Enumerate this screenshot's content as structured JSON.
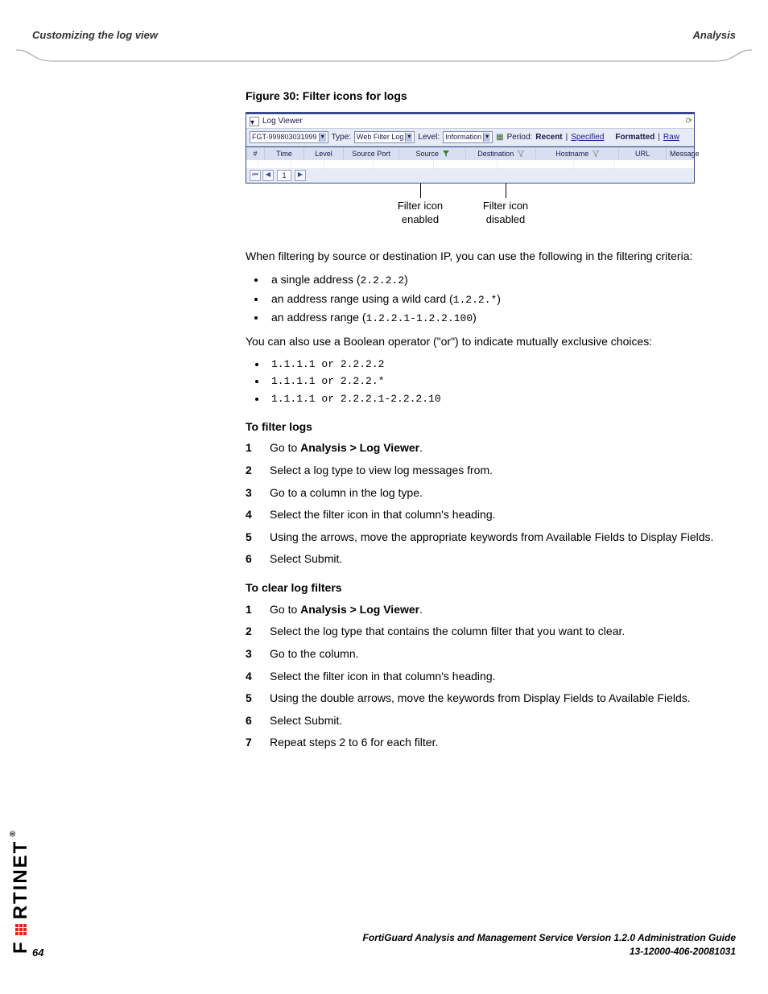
{
  "header": {
    "left": "Customizing the log view",
    "right": "Analysis"
  },
  "figure_caption": "Figure 30: Filter icons for logs",
  "log_viewer": {
    "title": "Log Viewer",
    "device": "FGT-999803031999",
    "type_label": "Type:",
    "type_value": "Web Filter Log",
    "level_label": "Level:",
    "level_value": "Information",
    "period_label": "Period:",
    "period_recent": "Recent",
    "period_specified": "Specified",
    "format_formatted": "Formatted",
    "format_raw": "Raw",
    "columns": {
      "num": "#",
      "time": "Time",
      "level": "Level",
      "source_port": "Source Port",
      "source": "Source",
      "destination": "Destination",
      "hostname": "Hostname",
      "url": "URL",
      "message": "Message"
    },
    "page_value": "1"
  },
  "callouts": {
    "enabled": "Filter icon\nenabled",
    "disabled": "Filter icon\ndisabled"
  },
  "intro_p1": "When filtering by source or destination IP, you can use the following in the filtering criteria:",
  "criteria": {
    "c1_pre": "a single address (",
    "c1_code": "2.2.2.2",
    "c1_post": ")",
    "c2_pre": "an address range using a wild card (",
    "c2_code": "1.2.2.*",
    "c2_post": ")",
    "c3_pre": "an address range (",
    "c3_code": "1.2.2.1-1.2.2.100",
    "c3_post": ")"
  },
  "intro_p2": "You can also use a Boolean operator (\"or\") to indicate mutually exclusive choices:",
  "boolean_examples": {
    "b1": "1.1.1.1 or 2.2.2.2",
    "b2": "1.1.1.1 or 2.2.2.*",
    "b3": "1.1.1.1 or 2.2.2.1-2.2.2.10"
  },
  "proc_filter_title": "To filter logs",
  "proc_filter": {
    "s1_pre": "Go to ",
    "s1_bold": "Analysis > Log Viewer",
    "s1_post": ".",
    "s2": "Select a log type to view log messages from.",
    "s3": "Go to a column in the log type.",
    "s4": "Select the filter icon in that column's heading.",
    "s5": "Using the arrows, move the appropriate keywords from Available Fields to Display Fields.",
    "s6": "Select Submit."
  },
  "proc_clear_title": "To clear log filters",
  "proc_clear": {
    "s1_pre": "Go to ",
    "s1_bold": "Analysis > Log Viewer",
    "s1_post": ".",
    "s2": "Select the log type that contains the column filter that you want to clear.",
    "s3": "Go to the column.",
    "s4": "Select the filter icon in that column's heading.",
    "s5": "Using the double arrows, move the keywords from Display Fields to Available Fields.",
    "s6": "Select Submit.",
    "s7": "Repeat steps 2 to 6 for each filter."
  },
  "footer": {
    "line1": "FortiGuard Analysis and Management Service Version 1.2.0 Administration Guide",
    "line2": "13-12000-406-20081031"
  },
  "page_number": "64",
  "brand": {
    "t1": "F",
    "t2": "RTINET"
  }
}
